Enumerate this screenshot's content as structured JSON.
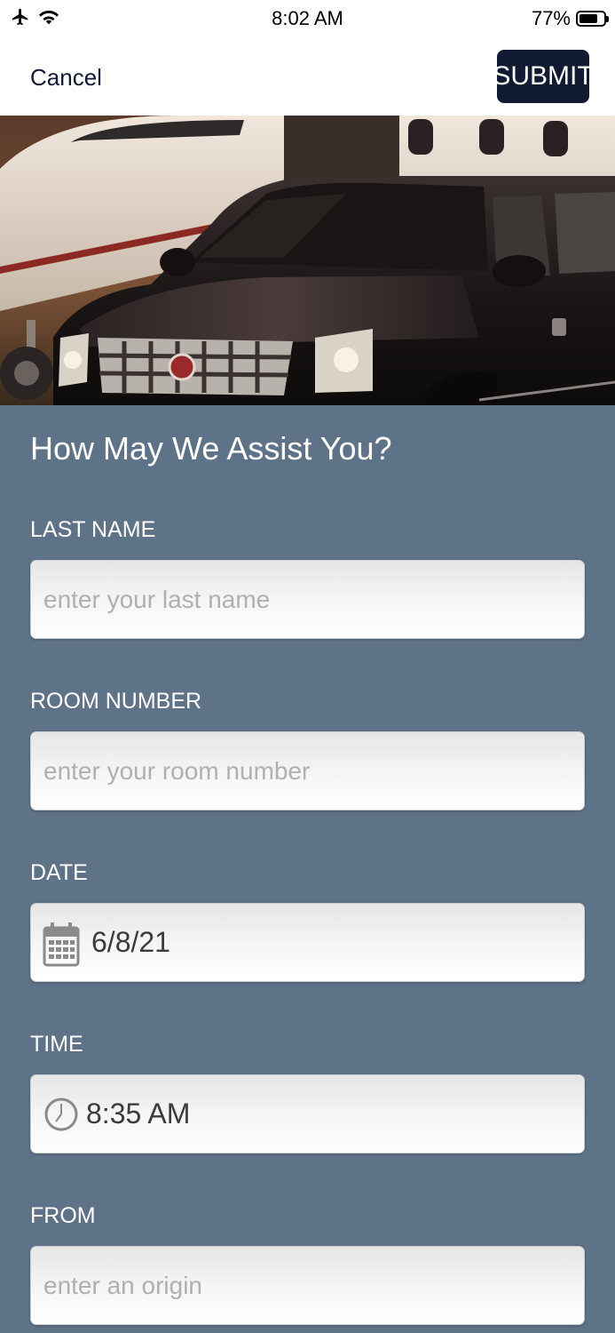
{
  "status_bar": {
    "time": "8:02 AM",
    "battery_percent": "77%",
    "battery_level": 0.77,
    "icons": [
      "airplane-mode-icon",
      "wifi-icon",
      "battery-icon"
    ]
  },
  "nav": {
    "cancel_label": "Cancel",
    "submit_label": "SUBMIT"
  },
  "form": {
    "title": "How May We Assist You?",
    "last_name": {
      "label": "LAST NAME",
      "placeholder": "enter your last name",
      "value": ""
    },
    "room_number": {
      "label": "ROOM NUMBER",
      "placeholder": "enter your room number",
      "value": ""
    },
    "date": {
      "label": "DATE",
      "value": "6/8/21",
      "icon": "calendar-icon"
    },
    "time": {
      "label": "TIME",
      "value": "8:35 AM",
      "icon": "clock-icon"
    },
    "from": {
      "label": "FROM",
      "placeholder": "enter an origin",
      "value": ""
    }
  },
  "colors": {
    "nav_dark": "#111a33",
    "form_background": "#5f7388",
    "field_placeholder": "#b0b0b0"
  }
}
